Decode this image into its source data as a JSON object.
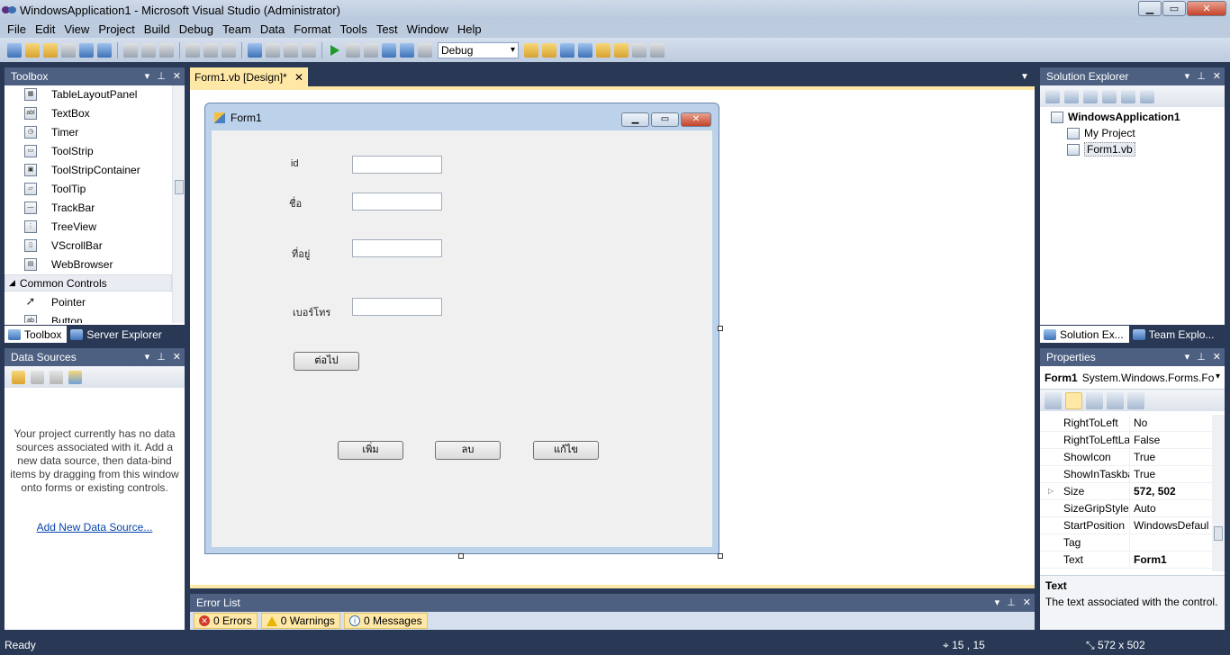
{
  "window": {
    "title": "WindowsApplication1 - Microsoft Visual Studio (Administrator)",
    "minimize": "▁",
    "maximize": "▭",
    "close": "✕"
  },
  "menu": [
    "File",
    "Edit",
    "View",
    "Project",
    "Build",
    "Debug",
    "Team",
    "Data",
    "Format",
    "Tools",
    "Test",
    "Window",
    "Help"
  ],
  "toolbar": {
    "config": "Debug"
  },
  "toolbox": {
    "title": "Toolbox",
    "items": [
      {
        "label": "TableLayoutPanel",
        "glyph": "▦"
      },
      {
        "label": "TextBox",
        "glyph": "abl"
      },
      {
        "label": "Timer",
        "glyph": "◷"
      },
      {
        "label": "ToolStrip",
        "glyph": "▭"
      },
      {
        "label": "ToolStripContainer",
        "glyph": "▣"
      },
      {
        "label": "ToolTip",
        "glyph": "▱"
      },
      {
        "label": "TrackBar",
        "glyph": "—"
      },
      {
        "label": "TreeView",
        "glyph": "⋮"
      },
      {
        "label": "VScrollBar",
        "glyph": "▯"
      },
      {
        "label": "WebBrowser",
        "glyph": "▤"
      }
    ],
    "group": "Common Controls",
    "after_items": [
      {
        "label": "Pointer",
        "glyph": "➚"
      },
      {
        "label": "Button",
        "glyph": "ab"
      }
    ],
    "tabs": [
      "Toolbox",
      "Server Explorer"
    ]
  },
  "datasources": {
    "title": "Data Sources",
    "message": "Your project currently has no data sources associated with it. Add a new data source, then data-bind items by dragging from this window onto forms or existing controls.",
    "link": "Add New Data Source..."
  },
  "document": {
    "tab": "Form1.vb [Design]*",
    "form_title": "Form1",
    "labels": {
      "id": "id",
      "name": "ชื่อ",
      "address": "ที่อยู่",
      "phone": "เบอร์โทร"
    },
    "buttons": {
      "next": "ต่อไป",
      "add": "เพิ่ม",
      "delete": "ลบ",
      "edit": "แก้ไข"
    }
  },
  "errorlist": {
    "title": "Error List",
    "errors": "0 Errors",
    "warnings": "0 Warnings",
    "messages": "0 Messages"
  },
  "solution": {
    "title": "Solution Explorer",
    "root": "WindowsApplication1",
    "children": [
      "My Project",
      "Form1.vb"
    ],
    "tabs": [
      "Solution Ex...",
      "Team Explo..."
    ]
  },
  "properties": {
    "title": "Properties",
    "object": "Form1",
    "object_type": "System.Windows.Forms.Fo",
    "rows": [
      {
        "name": "RightToLeft",
        "value": "No"
      },
      {
        "name": "RightToLeftLa",
        "value": "False"
      },
      {
        "name": "ShowIcon",
        "value": "True"
      },
      {
        "name": "ShowInTaskba",
        "value": "True"
      },
      {
        "name": "Size",
        "value": "572, 502"
      },
      {
        "name": "SizeGripStyle",
        "value": "Auto"
      },
      {
        "name": "StartPosition",
        "value": "WindowsDefaul"
      },
      {
        "name": "Tag",
        "value": ""
      },
      {
        "name": "Text",
        "value": "Form1"
      }
    ],
    "desc_title": "Text",
    "desc": "The text associated with the control."
  },
  "status": {
    "text": "Ready",
    "position": "15 , 15",
    "size": "572 x 502"
  }
}
